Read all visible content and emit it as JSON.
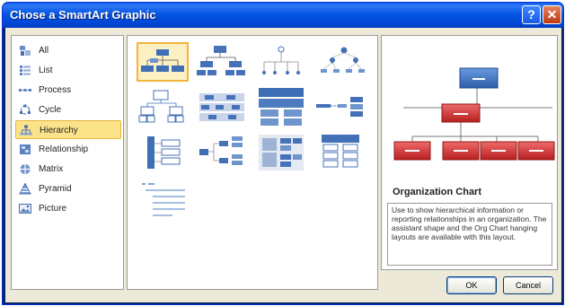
{
  "window": {
    "title": "Chose a SmartArt Graphic",
    "help_glyph": "?",
    "close_glyph": "✕"
  },
  "categories": [
    {
      "label": "All",
      "icon": "all-icon"
    },
    {
      "label": "List",
      "icon": "list-icon"
    },
    {
      "label": "Process",
      "icon": "process-icon"
    },
    {
      "label": "Cycle",
      "icon": "cycle-icon"
    },
    {
      "label": "Hierarchy",
      "icon": "hierarchy-icon",
      "selected": true
    },
    {
      "label": "Relationship",
      "icon": "relationship-icon"
    },
    {
      "label": "Matrix",
      "icon": "matrix-icon"
    },
    {
      "label": "Pyramid",
      "icon": "pyramid-icon"
    },
    {
      "label": "Picture",
      "icon": "picture-icon"
    }
  ],
  "layouts_selected_index": 0,
  "preview": {
    "title": "Organization Chart",
    "description": "Use to show hierarchical information or reporting relationships in an organization. The assistant shape and the Org Chart hanging layouts are available with this layout."
  },
  "buttons": {
    "ok": "OK",
    "cancel": "Cancel"
  },
  "colors": {
    "title_bar": "#0355e3",
    "selection_fill": "#fbe38a",
    "preview_top_box": "#3a6fb8",
    "preview_child_box": "#cc2b2b"
  }
}
